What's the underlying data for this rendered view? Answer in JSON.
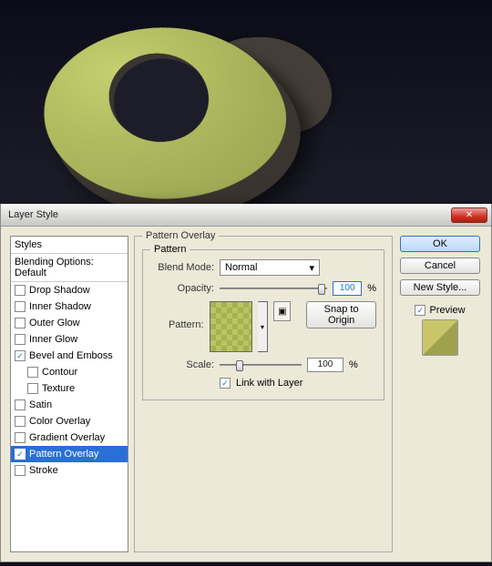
{
  "window": {
    "title": "Layer Style",
    "close_icon_name": "close-icon"
  },
  "styles_panel": {
    "header": "Styles",
    "blending_options": "Blending Options: Default",
    "items": [
      {
        "label": "Drop Shadow",
        "checked": false,
        "indent": false
      },
      {
        "label": "Inner Shadow",
        "checked": false,
        "indent": false
      },
      {
        "label": "Outer Glow",
        "checked": false,
        "indent": false
      },
      {
        "label": "Inner Glow",
        "checked": false,
        "indent": false
      },
      {
        "label": "Bevel and Emboss",
        "checked": true,
        "indent": false
      },
      {
        "label": "Contour",
        "checked": false,
        "indent": true
      },
      {
        "label": "Texture",
        "checked": false,
        "indent": true
      },
      {
        "label": "Satin",
        "checked": false,
        "indent": false
      },
      {
        "label": "Color Overlay",
        "checked": false,
        "indent": false
      },
      {
        "label": "Gradient Overlay",
        "checked": false,
        "indent": false
      },
      {
        "label": "Pattern Overlay",
        "checked": true,
        "indent": false,
        "selected": true
      },
      {
        "label": "Stroke",
        "checked": false,
        "indent": false
      }
    ]
  },
  "pattern_overlay": {
    "group_title": "Pattern Overlay",
    "subgroup_title": "Pattern",
    "blend_mode_label": "Blend Mode:",
    "blend_mode_value": "Normal",
    "opacity_label": "Opacity:",
    "opacity_value": "100",
    "opacity_unit": "%",
    "pattern_label": "Pattern:",
    "snap_button": "Snap to Origin",
    "scale_label": "Scale:",
    "scale_value": "100",
    "scale_unit": "%",
    "link_label": "Link with Layer",
    "link_checked": true
  },
  "right": {
    "ok": "OK",
    "cancel": "Cancel",
    "new_style": "New Style...",
    "preview_label": "Preview",
    "preview_checked": true
  }
}
